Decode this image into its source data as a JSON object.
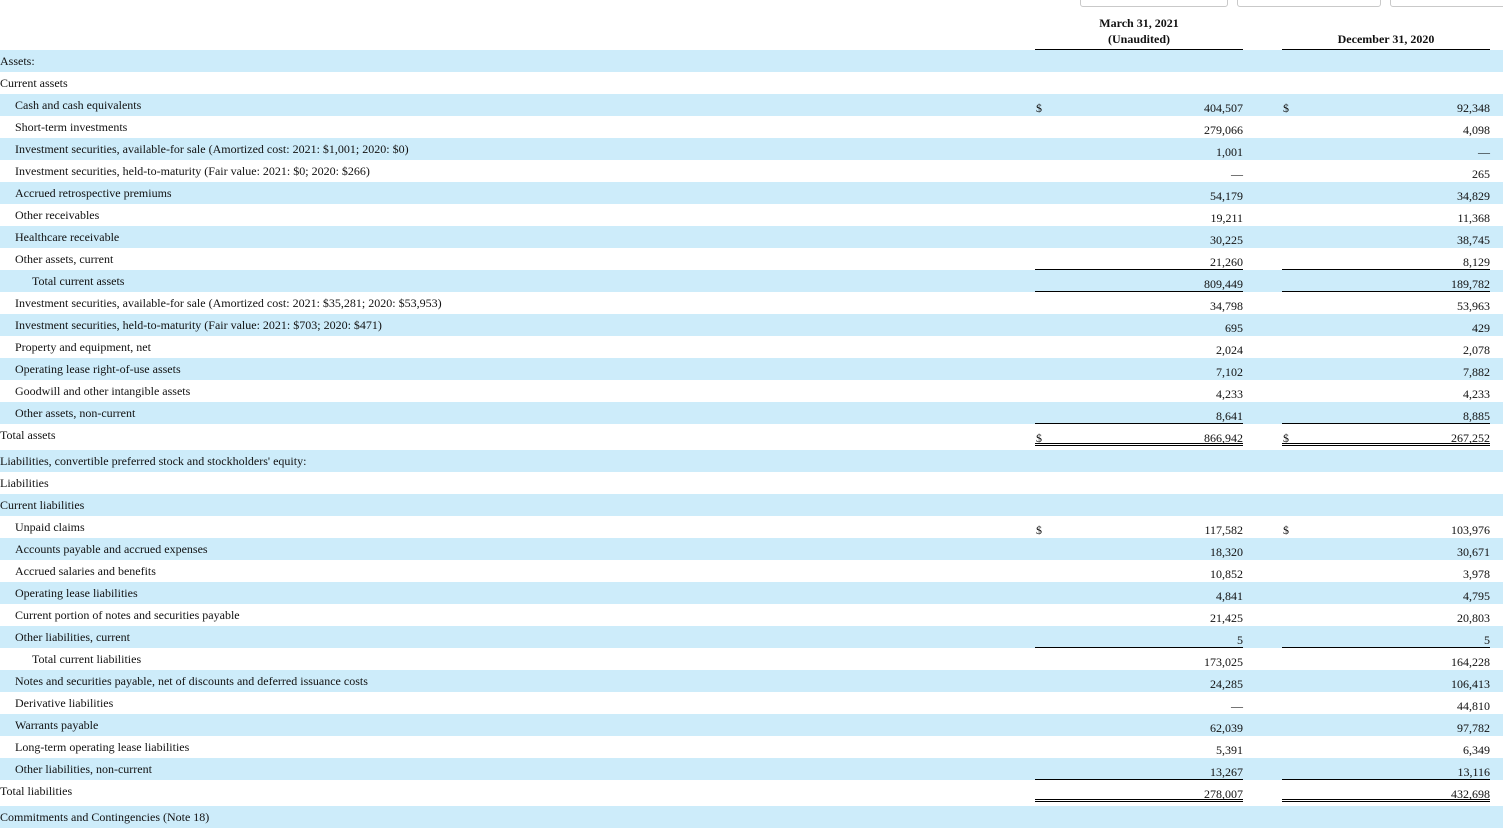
{
  "header": {
    "col1_line1": "March 31, 2021",
    "col1_line2": "(Unaudited)",
    "col2_line1": "December 31, 2020"
  },
  "rows": [
    {
      "label": "Assets:",
      "indent": 0,
      "shade": true,
      "c1": "",
      "c2": "",
      "cur1": "",
      "cur2": ""
    },
    {
      "label": "Current assets",
      "indent": 0,
      "shade": false,
      "c1": "",
      "c2": "",
      "cur1": "",
      "cur2": ""
    },
    {
      "label": "Cash and cash equivalents",
      "indent": 1,
      "shade": true,
      "c1": "404,507",
      "c2": "92,348",
      "cur1": "$",
      "cur2": "$"
    },
    {
      "label": "Short-term investments",
      "indent": 1,
      "shade": false,
      "c1": "279,066",
      "c2": "4,098",
      "cur1": "",
      "cur2": ""
    },
    {
      "label": "Investment securities, available-for sale (Amortized cost: 2021: $1,001; 2020: $0)",
      "indent": 1,
      "shade": true,
      "c1": "1,001",
      "c2": "—",
      "cur1": "",
      "cur2": ""
    },
    {
      "label": "Investment securities, held-to-maturity (Fair value: 2021: $0; 2020: $266)",
      "indent": 1,
      "shade": false,
      "c1": "—",
      "c2": "265",
      "cur1": "",
      "cur2": ""
    },
    {
      "label": "Accrued retrospective premiums",
      "indent": 1,
      "shade": true,
      "c1": "54,179",
      "c2": "34,829",
      "cur1": "",
      "cur2": ""
    },
    {
      "label": "Other receivables",
      "indent": 1,
      "shade": false,
      "c1": "19,211",
      "c2": "11,368",
      "cur1": "",
      "cur2": ""
    },
    {
      "label": "Healthcare receivable",
      "indent": 1,
      "shade": true,
      "c1": "30,225",
      "c2": "38,745",
      "cur1": "",
      "cur2": ""
    },
    {
      "label": "Other assets, current",
      "indent": 1,
      "shade": false,
      "c1": "21,260",
      "c2": "8,129",
      "cur1": "",
      "cur2": "",
      "border": "bb"
    },
    {
      "label": "Total current assets",
      "indent": 2,
      "shade": true,
      "c1": "809,449",
      "c2": "189,782",
      "cur1": "",
      "cur2": "",
      "border": "bb"
    },
    {
      "label": "Investment securities, available-for sale (Amortized cost: 2021: $35,281; 2020: $53,953)",
      "indent": 1,
      "shade": false,
      "c1": "34,798",
      "c2": "53,963",
      "cur1": "",
      "cur2": ""
    },
    {
      "label": "Investment securities, held-to-maturity (Fair value: 2021: $703; 2020: $471)",
      "indent": 1,
      "shade": true,
      "c1": "695",
      "c2": "429",
      "cur1": "",
      "cur2": ""
    },
    {
      "label": "Property and equipment, net",
      "indent": 1,
      "shade": false,
      "c1": "2,024",
      "c2": "2,078",
      "cur1": "",
      "cur2": ""
    },
    {
      "label": "Operating lease right-of-use assets",
      "indent": 1,
      "shade": true,
      "c1": "7,102",
      "c2": "7,882",
      "cur1": "",
      "cur2": ""
    },
    {
      "label": "Goodwill and other intangible assets",
      "indent": 1,
      "shade": false,
      "c1": "4,233",
      "c2": "4,233",
      "cur1": "",
      "cur2": ""
    },
    {
      "label": "Other assets, non-current",
      "indent": 1,
      "shade": true,
      "c1": "8,641",
      "c2": "8,885",
      "cur1": "",
      "cur2": "",
      "border": "bb"
    },
    {
      "label": "Total assets",
      "indent": 0,
      "shade": false,
      "c1": "866,942",
      "c2": "267,252",
      "cur1": "$",
      "cur2": "$",
      "border": "bb2",
      "tall": true
    },
    {
      "label": "Liabilities, convertible preferred stock and stockholders' equity:",
      "indent": 0,
      "shade": true,
      "c1": "",
      "c2": "",
      "cur1": "",
      "cur2": ""
    },
    {
      "label": "Liabilities",
      "indent": 0,
      "shade": false,
      "c1": "",
      "c2": "",
      "cur1": "",
      "cur2": ""
    },
    {
      "label": "Current liabilities",
      "indent": 0,
      "shade": true,
      "c1": "",
      "c2": "",
      "cur1": "",
      "cur2": ""
    },
    {
      "label": "Unpaid claims",
      "indent": 1,
      "shade": false,
      "c1": "117,582",
      "c2": "103,976",
      "cur1": "$",
      "cur2": "$"
    },
    {
      "label": "Accounts payable and accrued expenses",
      "indent": 1,
      "shade": true,
      "c1": "18,320",
      "c2": "30,671",
      "cur1": "",
      "cur2": ""
    },
    {
      "label": "Accrued salaries and benefits",
      "indent": 1,
      "shade": false,
      "c1": "10,852",
      "c2": "3,978",
      "cur1": "",
      "cur2": ""
    },
    {
      "label": "Operating lease liabilities",
      "indent": 1,
      "shade": true,
      "c1": "4,841",
      "c2": "4,795",
      "cur1": "",
      "cur2": ""
    },
    {
      "label": "Current portion of notes and securities payable",
      "indent": 1,
      "shade": false,
      "c1": "21,425",
      "c2": "20,803",
      "cur1": "",
      "cur2": ""
    },
    {
      "label": "Other liabilities, current",
      "indent": 1,
      "shade": true,
      "c1": "5",
      "c2": "5",
      "cur1": "",
      "cur2": "",
      "border": "bb"
    },
    {
      "label": "Total current liabilities",
      "indent": 2,
      "shade": false,
      "c1": "173,025",
      "c2": "164,228",
      "cur1": "",
      "cur2": ""
    },
    {
      "label": "Notes and securities payable, net of discounts and deferred issuance costs",
      "indent": 1,
      "shade": true,
      "c1": "24,285",
      "c2": "106,413",
      "cur1": "",
      "cur2": ""
    },
    {
      "label": "Derivative liabilities",
      "indent": 1,
      "shade": false,
      "c1": "—",
      "c2": "44,810",
      "cur1": "",
      "cur2": ""
    },
    {
      "label": "Warrants payable",
      "indent": 1,
      "shade": true,
      "c1": "62,039",
      "c2": "97,782",
      "cur1": "",
      "cur2": ""
    },
    {
      "label": "Long-term operating lease liabilities",
      "indent": 1,
      "shade": false,
      "c1": "5,391",
      "c2": "6,349",
      "cur1": "",
      "cur2": ""
    },
    {
      "label": "Other liabilities, non-current",
      "indent": 1,
      "shade": true,
      "c1": "13,267",
      "c2": "13,116",
      "cur1": "",
      "cur2": "",
      "border": "bb"
    },
    {
      "label": "Total liabilities",
      "indent": 0,
      "shade": false,
      "c1": "278,007",
      "c2": "432,698",
      "cur1": "",
      "cur2": "",
      "border": "bb2",
      "tall": true
    },
    {
      "label": "Commitments and Contingencies (Note 18)",
      "indent": 0,
      "shade": true,
      "c1": "",
      "c2": "",
      "cur1": "",
      "cur2": ""
    }
  ]
}
